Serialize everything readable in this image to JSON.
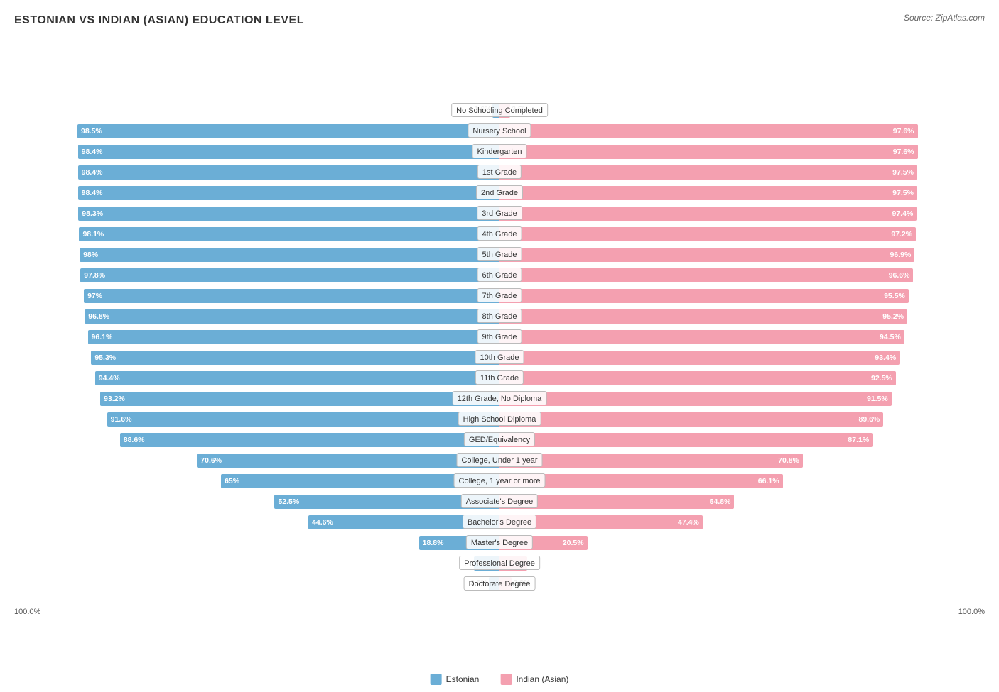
{
  "title": "ESTONIAN VS INDIAN (ASIAN) EDUCATION LEVEL",
  "source": "Source: ZipAtlas.com",
  "colors": {
    "estonian": "#6baed6",
    "indian": "#f4a0b0"
  },
  "legend": {
    "estonian_label": "Estonian",
    "indian_label": "Indian (Asian)"
  },
  "axis": {
    "left": "100.0%",
    "right": "100.0%"
  },
  "bars": [
    {
      "label": "No Schooling Completed",
      "estonian": 1.6,
      "indian": 2.5,
      "max": 100
    },
    {
      "label": "Nursery School",
      "estonian": 98.5,
      "indian": 97.6,
      "max": 100
    },
    {
      "label": "Kindergarten",
      "estonian": 98.4,
      "indian": 97.6,
      "max": 100
    },
    {
      "label": "1st Grade",
      "estonian": 98.4,
      "indian": 97.5,
      "max": 100
    },
    {
      "label": "2nd Grade",
      "estonian": 98.4,
      "indian": 97.5,
      "max": 100
    },
    {
      "label": "3rd Grade",
      "estonian": 98.3,
      "indian": 97.4,
      "max": 100
    },
    {
      "label": "4th Grade",
      "estonian": 98.1,
      "indian": 97.2,
      "max": 100
    },
    {
      "label": "5th Grade",
      "estonian": 98.0,
      "indian": 96.9,
      "max": 100
    },
    {
      "label": "6th Grade",
      "estonian": 97.8,
      "indian": 96.6,
      "max": 100
    },
    {
      "label": "7th Grade",
      "estonian": 97.0,
      "indian": 95.5,
      "max": 100
    },
    {
      "label": "8th Grade",
      "estonian": 96.8,
      "indian": 95.2,
      "max": 100
    },
    {
      "label": "9th Grade",
      "estonian": 96.1,
      "indian": 94.5,
      "max": 100
    },
    {
      "label": "10th Grade",
      "estonian": 95.3,
      "indian": 93.4,
      "max": 100
    },
    {
      "label": "11th Grade",
      "estonian": 94.4,
      "indian": 92.5,
      "max": 100
    },
    {
      "label": "12th Grade, No Diploma",
      "estonian": 93.2,
      "indian": 91.5,
      "max": 100
    },
    {
      "label": "High School Diploma",
      "estonian": 91.6,
      "indian": 89.6,
      "max": 100
    },
    {
      "label": "GED/Equivalency",
      "estonian": 88.6,
      "indian": 87.1,
      "max": 100
    },
    {
      "label": "College, Under 1 year",
      "estonian": 70.6,
      "indian": 70.8,
      "max": 100
    },
    {
      "label": "College, 1 year or more",
      "estonian": 65.0,
      "indian": 66.1,
      "max": 100
    },
    {
      "label": "Associate's Degree",
      "estonian": 52.5,
      "indian": 54.8,
      "max": 100
    },
    {
      "label": "Bachelor's Degree",
      "estonian": 44.6,
      "indian": 47.4,
      "max": 100
    },
    {
      "label": "Master's Degree",
      "estonian": 18.8,
      "indian": 20.5,
      "max": 100
    },
    {
      "label": "Professional Degree",
      "estonian": 6.0,
      "indian": 6.5,
      "max": 100
    },
    {
      "label": "Doctorate Degree",
      "estonian": 2.5,
      "indian": 2.9,
      "max": 100
    }
  ]
}
